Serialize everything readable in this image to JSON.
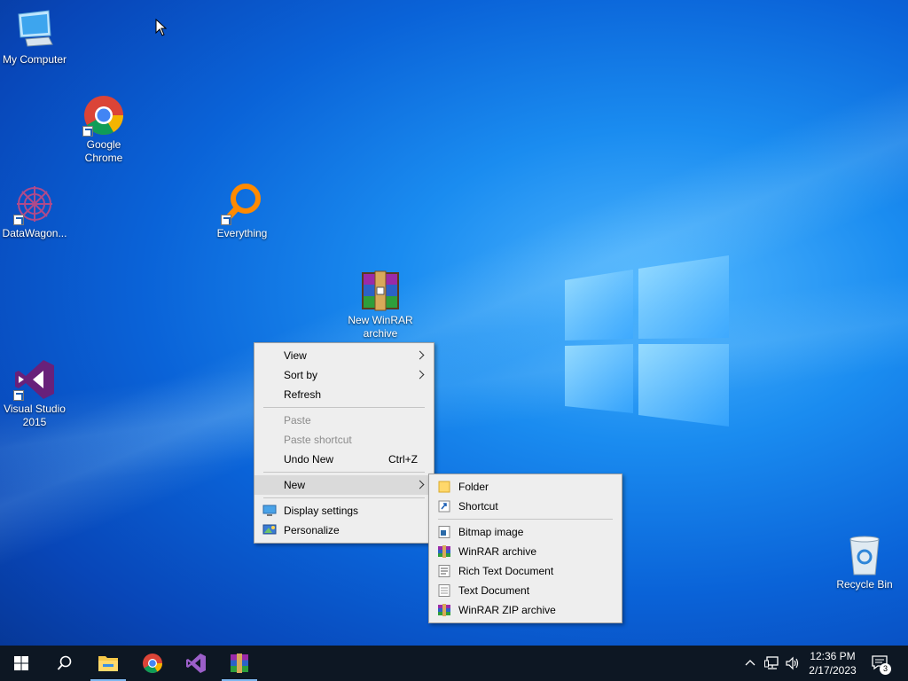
{
  "desktop": {
    "icons": [
      {
        "label": "My Computer"
      },
      {
        "label": "Google Chrome"
      },
      {
        "label": "DataWagon..."
      },
      {
        "label": "Everything"
      },
      {
        "label": "New WinRAR archive"
      },
      {
        "label": "Visual Studio 2015"
      },
      {
        "label": "Recycle Bin"
      }
    ]
  },
  "context_menu": {
    "view": "View",
    "sort_by": "Sort by",
    "refresh": "Refresh",
    "paste": "Paste",
    "paste_shortcut": "Paste shortcut",
    "undo_new": "Undo New",
    "undo_shortcut": "Ctrl+Z",
    "new": "New",
    "display_settings": "Display settings",
    "personalize": "Personalize"
  },
  "new_submenu": {
    "folder": "Folder",
    "shortcut": "Shortcut",
    "bitmap": "Bitmap image",
    "winrar_archive": "WinRAR archive",
    "rich_text": "Rich Text Document",
    "text_document": "Text Document",
    "winrar_zip": "WinRAR ZIP archive"
  },
  "taskbar": {
    "time": "12:36 PM",
    "date": "2/17/2023",
    "notification_count": "3"
  },
  "colors": {
    "taskbar": "#0d1723",
    "menu_bg": "#eeeeee",
    "menu_highlight": "#dadada"
  }
}
